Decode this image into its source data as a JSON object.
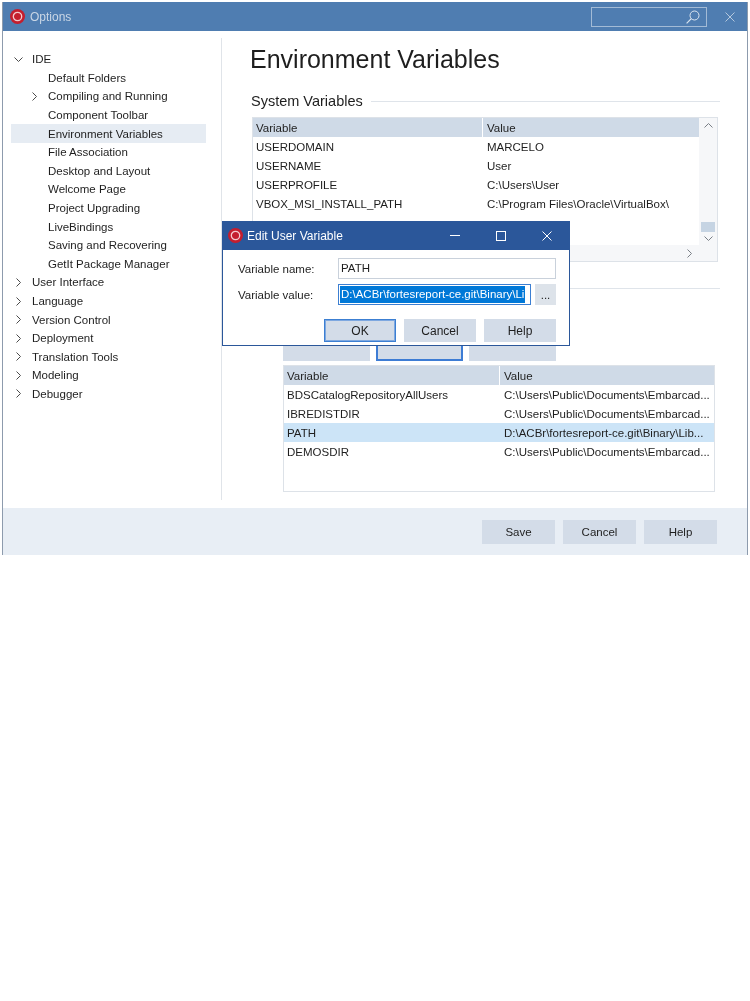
{
  "window": {
    "title": "Options"
  },
  "tree": [
    {
      "label": "IDE",
      "expanded": true,
      "selected": false,
      "children": [
        {
          "label": "Default Folders",
          "selected": false
        },
        {
          "label": "Compiling and Running",
          "expanded": false,
          "selected": false
        },
        {
          "label": "Component Toolbar",
          "selected": false
        },
        {
          "label": "Environment Variables",
          "selected": true
        },
        {
          "label": "File Association",
          "selected": false
        },
        {
          "label": "Desktop and Layout",
          "selected": false
        },
        {
          "label": "Welcome Page",
          "selected": false
        },
        {
          "label": "Project Upgrading",
          "selected": false
        },
        {
          "label": "LiveBindings",
          "selected": false
        },
        {
          "label": "Saving and Recovering",
          "selected": false
        },
        {
          "label": "GetIt Package Manager",
          "selected": false
        }
      ]
    },
    {
      "label": "User Interface",
      "expanded": false,
      "selected": false
    },
    {
      "label": "Language",
      "expanded": false,
      "selected": false
    },
    {
      "label": "Version Control",
      "expanded": false,
      "selected": false
    },
    {
      "label": "Deployment",
      "expanded": false,
      "selected": false
    },
    {
      "label": "Translation Tools",
      "expanded": false,
      "selected": false
    },
    {
      "label": "Modeling",
      "expanded": false,
      "selected": false
    },
    {
      "label": "Debugger",
      "expanded": false,
      "selected": false
    }
  ],
  "page": {
    "heading": "Environment Variables",
    "system_variables": {
      "title": "System Variables",
      "columns": [
        "Variable",
        "Value"
      ],
      "rows": [
        {
          "variable": "USERDOMAIN",
          "value": "MARCELO",
          "selected": false
        },
        {
          "variable": "USERNAME",
          "value": "User",
          "selected": false
        },
        {
          "variable": "USERPROFILE",
          "value": "C:\\Users\\User",
          "selected": false
        },
        {
          "variable": "VBOX_MSI_INSTALL_PATH",
          "value": "C:\\Program Files\\Oracle\\VirtualBox\\",
          "selected": false
        }
      ]
    },
    "user_variable_buttons": [
      {
        "focused": false
      },
      {
        "focused": true
      },
      {
        "focused": false
      }
    ],
    "user_variables": {
      "columns": [
        "Variable",
        "Value"
      ],
      "rows": [
        {
          "variable": "BDSCatalogRepositoryAllUsers",
          "value": "C:\\Users\\Public\\Documents\\Embarcad...",
          "selected": false
        },
        {
          "variable": "IBREDISTDIR",
          "value": "C:\\Users\\Public\\Documents\\Embarcad...",
          "selected": false
        },
        {
          "variable": "PATH",
          "value": "D:\\ACBr\\fortesreport-ce.git\\Binary\\Lib...",
          "selected": true
        },
        {
          "variable": "DEMOSDIR",
          "value": "C:\\Users\\Public\\Documents\\Embarcad...",
          "selected": false
        }
      ]
    }
  },
  "footer": {
    "buttons": [
      "Save",
      "Cancel",
      "Help"
    ]
  },
  "dialog": {
    "title": "Edit User Variable",
    "fields": [
      {
        "label": "Variable name:",
        "value": "PATH",
        "focused": false,
        "text_selected": false
      },
      {
        "label": "Variable value:",
        "value": "D:\\ACBr\\fortesreport-ce.git\\Binary\\Li",
        "focused": true,
        "text_selected": true
      }
    ],
    "browse_button": "...",
    "buttons": [
      {
        "label": "OK",
        "default": true
      },
      {
        "label": "Cancel",
        "default": false
      },
      {
        "label": "Help",
        "default": false
      }
    ]
  }
}
